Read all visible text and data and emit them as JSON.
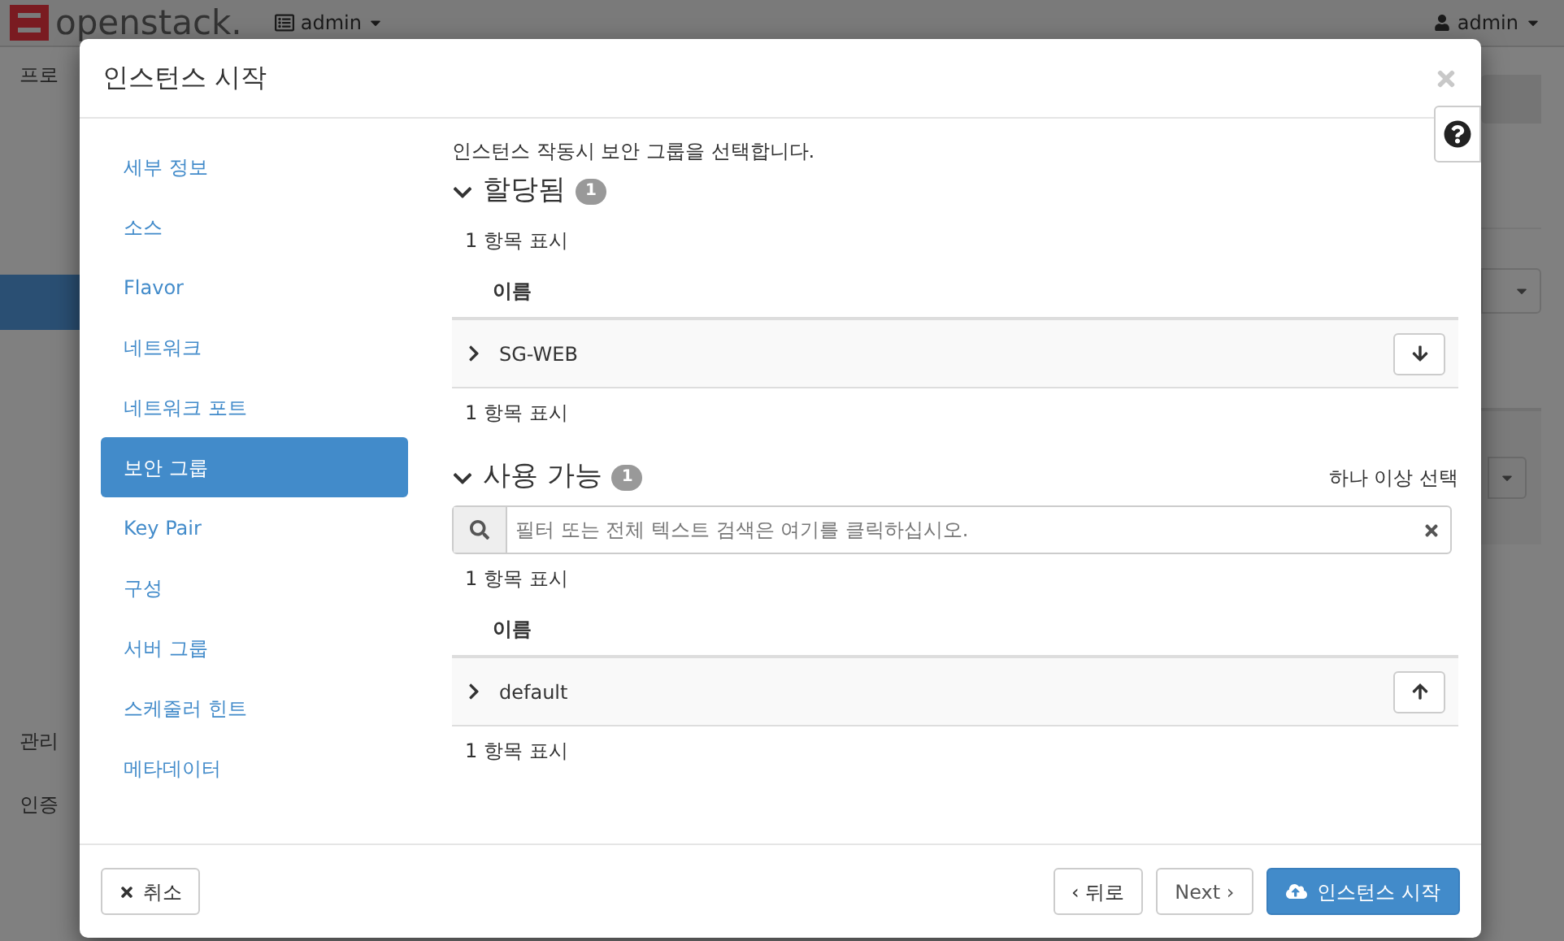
{
  "topbar": {
    "logo": "openstack.",
    "project": "admin",
    "user": "admin"
  },
  "sidenav": [
    {
      "label": "프로",
      "selected": false
    },
    {
      "selected": true
    },
    {
      "label": "관리",
      "selected": false
    },
    {
      "label": "인증",
      "selected": false
    }
  ],
  "modal": {
    "title": "인스턴스 시작",
    "steps": [
      {
        "label": "세부 정보",
        "selected": false
      },
      {
        "label": "소스",
        "selected": false
      },
      {
        "label": "Flavor",
        "selected": false
      },
      {
        "label": "네트워크",
        "selected": false
      },
      {
        "label": "네트워크 포트",
        "selected": false
      },
      {
        "label": "보안 그룹",
        "selected": true
      },
      {
        "label": "Key Pair",
        "selected": false
      },
      {
        "label": "구성",
        "selected": false
      },
      {
        "label": "서버 그룹",
        "selected": false
      },
      {
        "label": "스케줄러 힌트",
        "selected": false
      },
      {
        "label": "메타데이터",
        "selected": false
      }
    ],
    "description": "인스턴스 작동시 보안 그룹을 선택합니다.",
    "sections": [
      {
        "title": "할당됨",
        "count": "1",
        "expanded": true,
        "summary_top": "1 항목 표시",
        "column": "이름",
        "rows": [
          {
            "name": "SG-WEB",
            "kind": "remove"
          }
        ],
        "summary_bottom": "1 항목 표시"
      },
      {
        "title": "사용 가능",
        "count": "1",
        "expanded": true,
        "hint": "하나 이상 선택",
        "search_placeholder": "필터 또는 전체 텍스트 검색은 여기를 클릭하십시오.",
        "summary_top": "1 항목 표시",
        "column": "이름",
        "rows": [
          {
            "name": "default",
            "kind": "add"
          }
        ],
        "summary_bottom": "1 항목 표시"
      }
    ],
    "buttons": {
      "cancel": "취소",
      "back": "‹ 뒤로",
      "next": "Next ›",
      "launch": "인스턴스 시작"
    }
  }
}
